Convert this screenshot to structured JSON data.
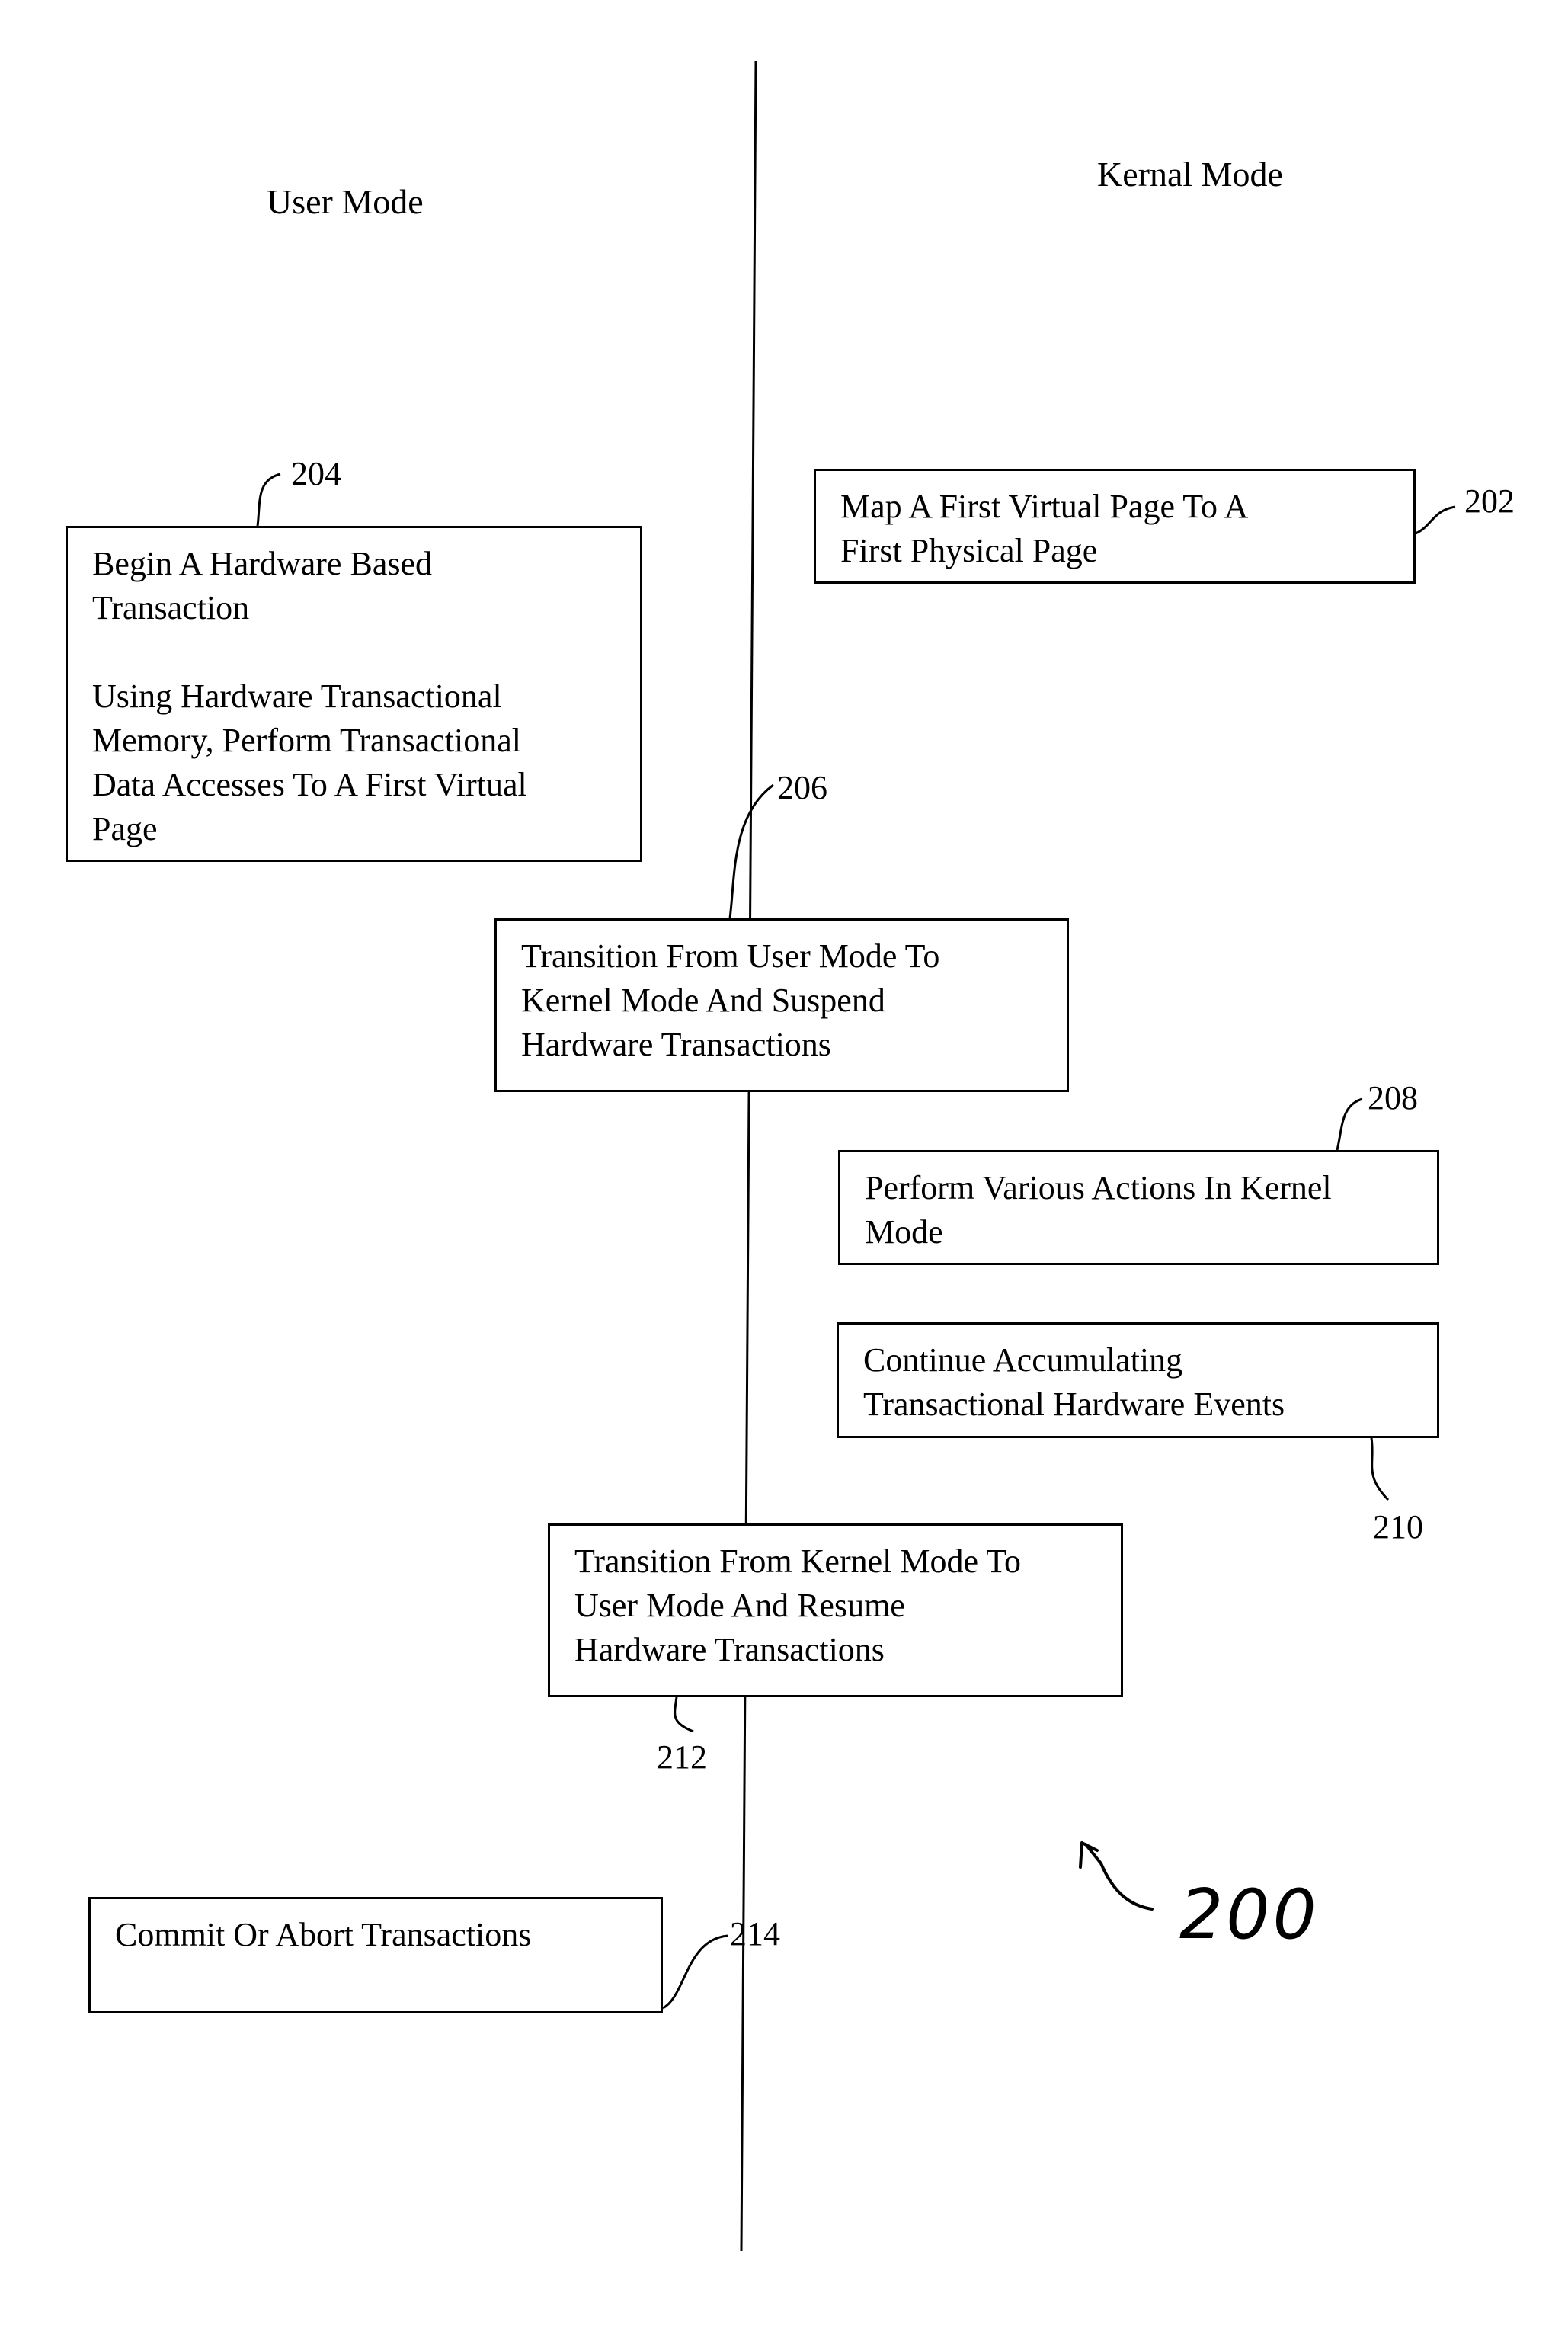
{
  "lanes": {
    "user": "User Mode",
    "kernel": "Kernal Mode"
  },
  "steps": [
    {
      "ref": "202",
      "lane": "kernel",
      "lines": [
        "Map A First Virtual Page To A",
        "First Physical Page"
      ]
    },
    {
      "ref": "204",
      "lane": "user",
      "lines": [
        "Begin A Hardware Based",
        "Transaction"
      ],
      "lines2": [
        "Using Hardware Transactional",
        "Memory, Perform Transactional",
        "Data Accesses To A First Virtual",
        "Page"
      ]
    },
    {
      "ref": "206",
      "lane": "boundary",
      "lines": [
        "Transition From User Mode To",
        "Kernel Mode And Suspend",
        "Hardware Transactions"
      ]
    },
    {
      "ref": "208",
      "lane": "kernel",
      "lines": [
        "Perform Various Actions In Kernel",
        "Mode"
      ]
    },
    {
      "ref": "210",
      "lane": "kernel",
      "lines": [
        "Continue Accumulating",
        "Transactional Hardware Events"
      ]
    },
    {
      "ref": "212",
      "lane": "boundary",
      "lines": [
        "Transition From Kernel Mode To",
        "User Mode And Resume",
        "Hardware Transactions"
      ]
    },
    {
      "ref": "214",
      "lane": "user",
      "lines": [
        "Commit Or Abort Transactions"
      ]
    }
  ],
  "figure_ref": "200"
}
